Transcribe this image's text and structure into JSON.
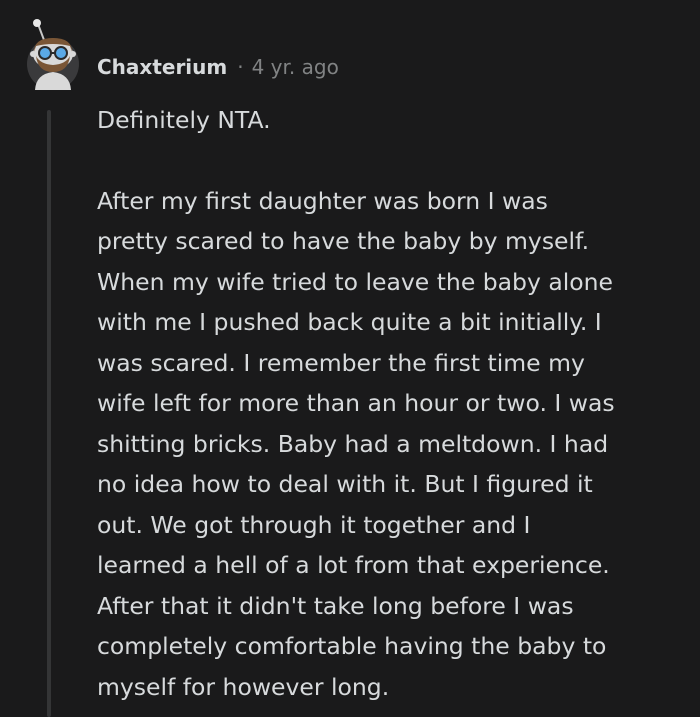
{
  "comment": {
    "avatar_icon": "snoo-avatar-icon",
    "username": "Chaxterium",
    "separator": "·",
    "timestamp": "4 yr. ago",
    "paragraphs": [
      "Definitely NTA.",
      "After my first daughter was born I was\npretty scared to have the baby by myself.\nWhen my wife tried to leave the baby alone\nwith me I pushed back quite a bit initially. I\nwas scared. I remember the first time my\nwife left for more than an hour or two. I was\nshitting bricks. Baby had a meltdown. I had\nno idea how to deal with it. But I figured it\nout. We got through it together and I\nlearned a hell of a lot from that experience.\nAfter that it didn't take long before I was\ncompletely comfortable having the baby to\nmyself for however long."
    ]
  },
  "colors": {
    "background": "#1a1a1b",
    "text": "#d7dadc",
    "muted": "#818384",
    "thread_line": "#343536"
  }
}
